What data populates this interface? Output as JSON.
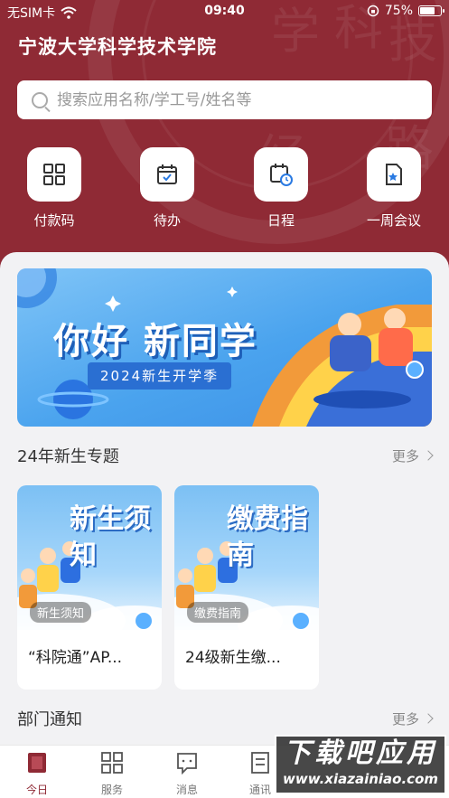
{
  "status": {
    "carrier": "无SIM卡",
    "time": "09:40",
    "battery": "75%",
    "battery_level": 0.75
  },
  "app": {
    "title": "宁波大学科学技术学院"
  },
  "search": {
    "placeholder": "搜索应用名称/学工号/姓名等"
  },
  "quick_actions": [
    {
      "label": "付款码",
      "icon": "qrcode-icon"
    },
    {
      "label": "待办",
      "icon": "todo-calendar-icon"
    },
    {
      "label": "日程",
      "icon": "schedule-icon"
    },
    {
      "label": "一周会议",
      "icon": "meeting-doc-icon"
    }
  ],
  "banner": {
    "title": "你好 新同学",
    "subtitle": "2024新生开学季"
  },
  "section_new": {
    "title": "24年新生专题",
    "more": "更多"
  },
  "cards": [
    {
      "art": "新生须知",
      "tag": "新生须知",
      "title": "“科院通”AP..."
    },
    {
      "art": "缴费指南",
      "tag": "缴费指南",
      "title": "24级新生缴..."
    }
  ],
  "section_notice": {
    "title": "部门通知",
    "more": "更多"
  },
  "tabs": [
    {
      "label": "今日",
      "icon": "today-icon",
      "active": true
    },
    {
      "label": "服务",
      "icon": "grid-icon",
      "active": false
    },
    {
      "label": "消息",
      "icon": "message-icon",
      "active": false
    },
    {
      "label": "通讯",
      "icon": "contacts-icon",
      "active": false
    }
  ],
  "watermark": {
    "big": "下载吧应用",
    "small": "www.xiazainiao.com"
  },
  "colors": {
    "brand": "#8f2a35",
    "banner": "#4aa3ee"
  }
}
